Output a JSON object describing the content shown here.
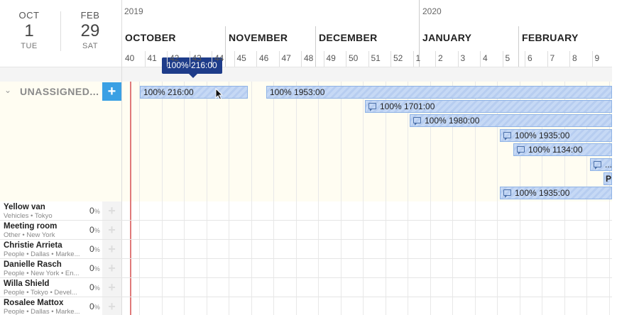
{
  "range": {
    "start": {
      "month": "OCT",
      "day": "1",
      "weekday": "TUE"
    },
    "end": {
      "month": "FEB",
      "day": "29",
      "weekday": "SAT"
    }
  },
  "timeline": {
    "years": [
      "2019",
      "2020"
    ],
    "months": [
      "OCTOBER",
      "NOVEMBER",
      "DECEMBER",
      "JANUARY",
      "FEBRUARY"
    ],
    "weeks": [
      "40",
      "41",
      "42",
      "43",
      "44",
      "45",
      "46",
      "47",
      "48",
      "49",
      "50",
      "51",
      "52",
      "1",
      "2",
      "3",
      "4",
      "5",
      "6",
      "7",
      "8",
      "9"
    ]
  },
  "tooltip": {
    "text": "100% 216:00"
  },
  "unassigned": {
    "label": "UNASSIGNED...",
    "add_label": "+",
    "bars": [
      {
        "text": "100% 216:00",
        "icon": ""
      },
      {
        "text": "100% 1953:00",
        "icon": ""
      },
      {
        "text": "100% 1701:00",
        "icon": "comment-icon"
      },
      {
        "text": "100% 1980:00",
        "icon": "comment-icon"
      },
      {
        "text": "100% 1935:00",
        "icon": "comment-icon"
      },
      {
        "text": "100% 1134:00",
        "icon": "comment-icon"
      },
      {
        "text": "...",
        "icon": "comment-icon"
      },
      {
        "text": "Pr",
        "icon": ""
      },
      {
        "text": "100% 1935:00",
        "icon": "comment-icon"
      }
    ]
  },
  "resources": [
    {
      "name": "Yellow van",
      "meta": "Vehicles • Tokyo",
      "pct": "0",
      "unit": "%"
    },
    {
      "name": "Meeting room",
      "meta": "Other • New York",
      "pct": "0",
      "unit": "%"
    },
    {
      "name": "Christie Arrieta",
      "meta": "People • Dallas • Marke...",
      "pct": "0",
      "unit": "%"
    },
    {
      "name": "Danielle Rasch",
      "meta": "People • New York • En...",
      "pct": "0",
      "unit": "%"
    },
    {
      "name": "Willa Shield",
      "meta": "People • Tokyo • Devel...",
      "pct": "0",
      "unit": "%"
    },
    {
      "name": "Rosalee Mattox",
      "meta": "People • Dallas • Marke...",
      "pct": "0",
      "unit": "%"
    }
  ],
  "colors": {
    "accent": "#3aa0e4",
    "today": "#e07a7a",
    "tooltip": "#1e3c8a",
    "bar": "#c6d9f5"
  }
}
